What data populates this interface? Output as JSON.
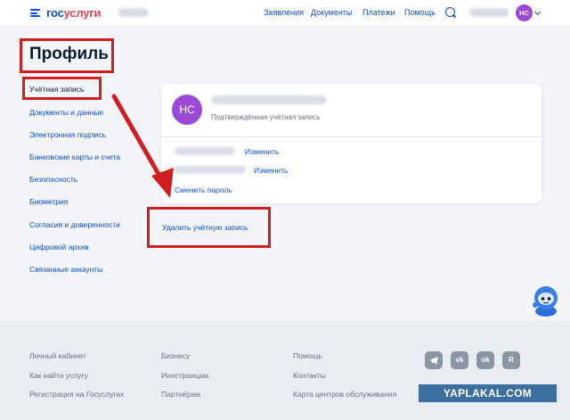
{
  "header": {
    "logo_part1": "гос",
    "logo_part2": "услуги",
    "nav": [
      "Заявления",
      "Документы",
      "Платежи",
      "Помощь"
    ],
    "avatar_initials": "НС"
  },
  "page": {
    "title": "Профиль"
  },
  "sidebar": {
    "items": [
      {
        "label": "Учётная запись"
      },
      {
        "label": "Документы и данные"
      },
      {
        "label": "Электронная подпись"
      },
      {
        "label": "Банковские карты и счета"
      },
      {
        "label": "Безопасность"
      },
      {
        "label": "Биометрия"
      },
      {
        "label": "Согласия и доверенности"
      },
      {
        "label": "Цифровой архив"
      },
      {
        "label": "Связанные аккаунты"
      }
    ]
  },
  "account": {
    "avatar_initials": "НС",
    "status": "Подтверждённая учётная запись",
    "edit_phone": "Изменить",
    "edit_email": "Изменить",
    "change_password": "Сменить пароль",
    "delete_account": "Удалить учётную запись"
  },
  "footer": {
    "col1": [
      "Личный кабинет",
      "Как найти услугу",
      "Регистрация на Госуслугах"
    ],
    "col2": [
      "Бизнесу",
      "Иностранцам",
      "Партнёрам"
    ],
    "col3": [
      "Помощь",
      "Контакты",
      "Карта центров обслуживания"
    ],
    "social": [
      "telegram-icon",
      "vk-icon",
      "ok-icon",
      "rutube-icon"
    ],
    "social_glyphs": [
      "",
      "vk",
      "ok",
      "R"
    ]
  },
  "watermark": "YAPLAKAL.COM",
  "colors": {
    "accent": "#0d4cd3",
    "avatar": "#9b4ad8",
    "highlight": "#d11e21"
  }
}
